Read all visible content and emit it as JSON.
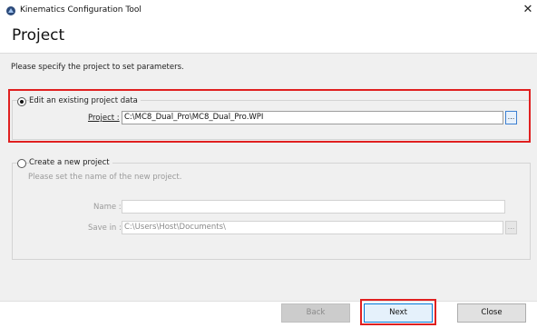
{
  "window": {
    "title": "Kinematics Configuration Tool",
    "close_glyph": "✕"
  },
  "page": {
    "title": "Project",
    "instruction": "Please specify the project to set parameters."
  },
  "existing": {
    "option_label": "Edit an existing project data",
    "selected": true,
    "project_label": "Project :",
    "project_value": "C:\\MC8_Dual_Pro\\MC8_Dual_Pro.WPI",
    "browse_label": "..."
  },
  "new_project": {
    "option_label": "Create a new project",
    "selected": false,
    "description": "Please set the name of the new project.",
    "name_label": "Name :",
    "name_value": "",
    "save_label": "Save in :",
    "save_value": "C:\\Users\\Host\\Documents\\",
    "browse_label": "..."
  },
  "buttons": {
    "back": "Back",
    "next": "Next",
    "close": "Close"
  },
  "colors": {
    "highlight": "#e02020",
    "accent": "#0078d7"
  }
}
